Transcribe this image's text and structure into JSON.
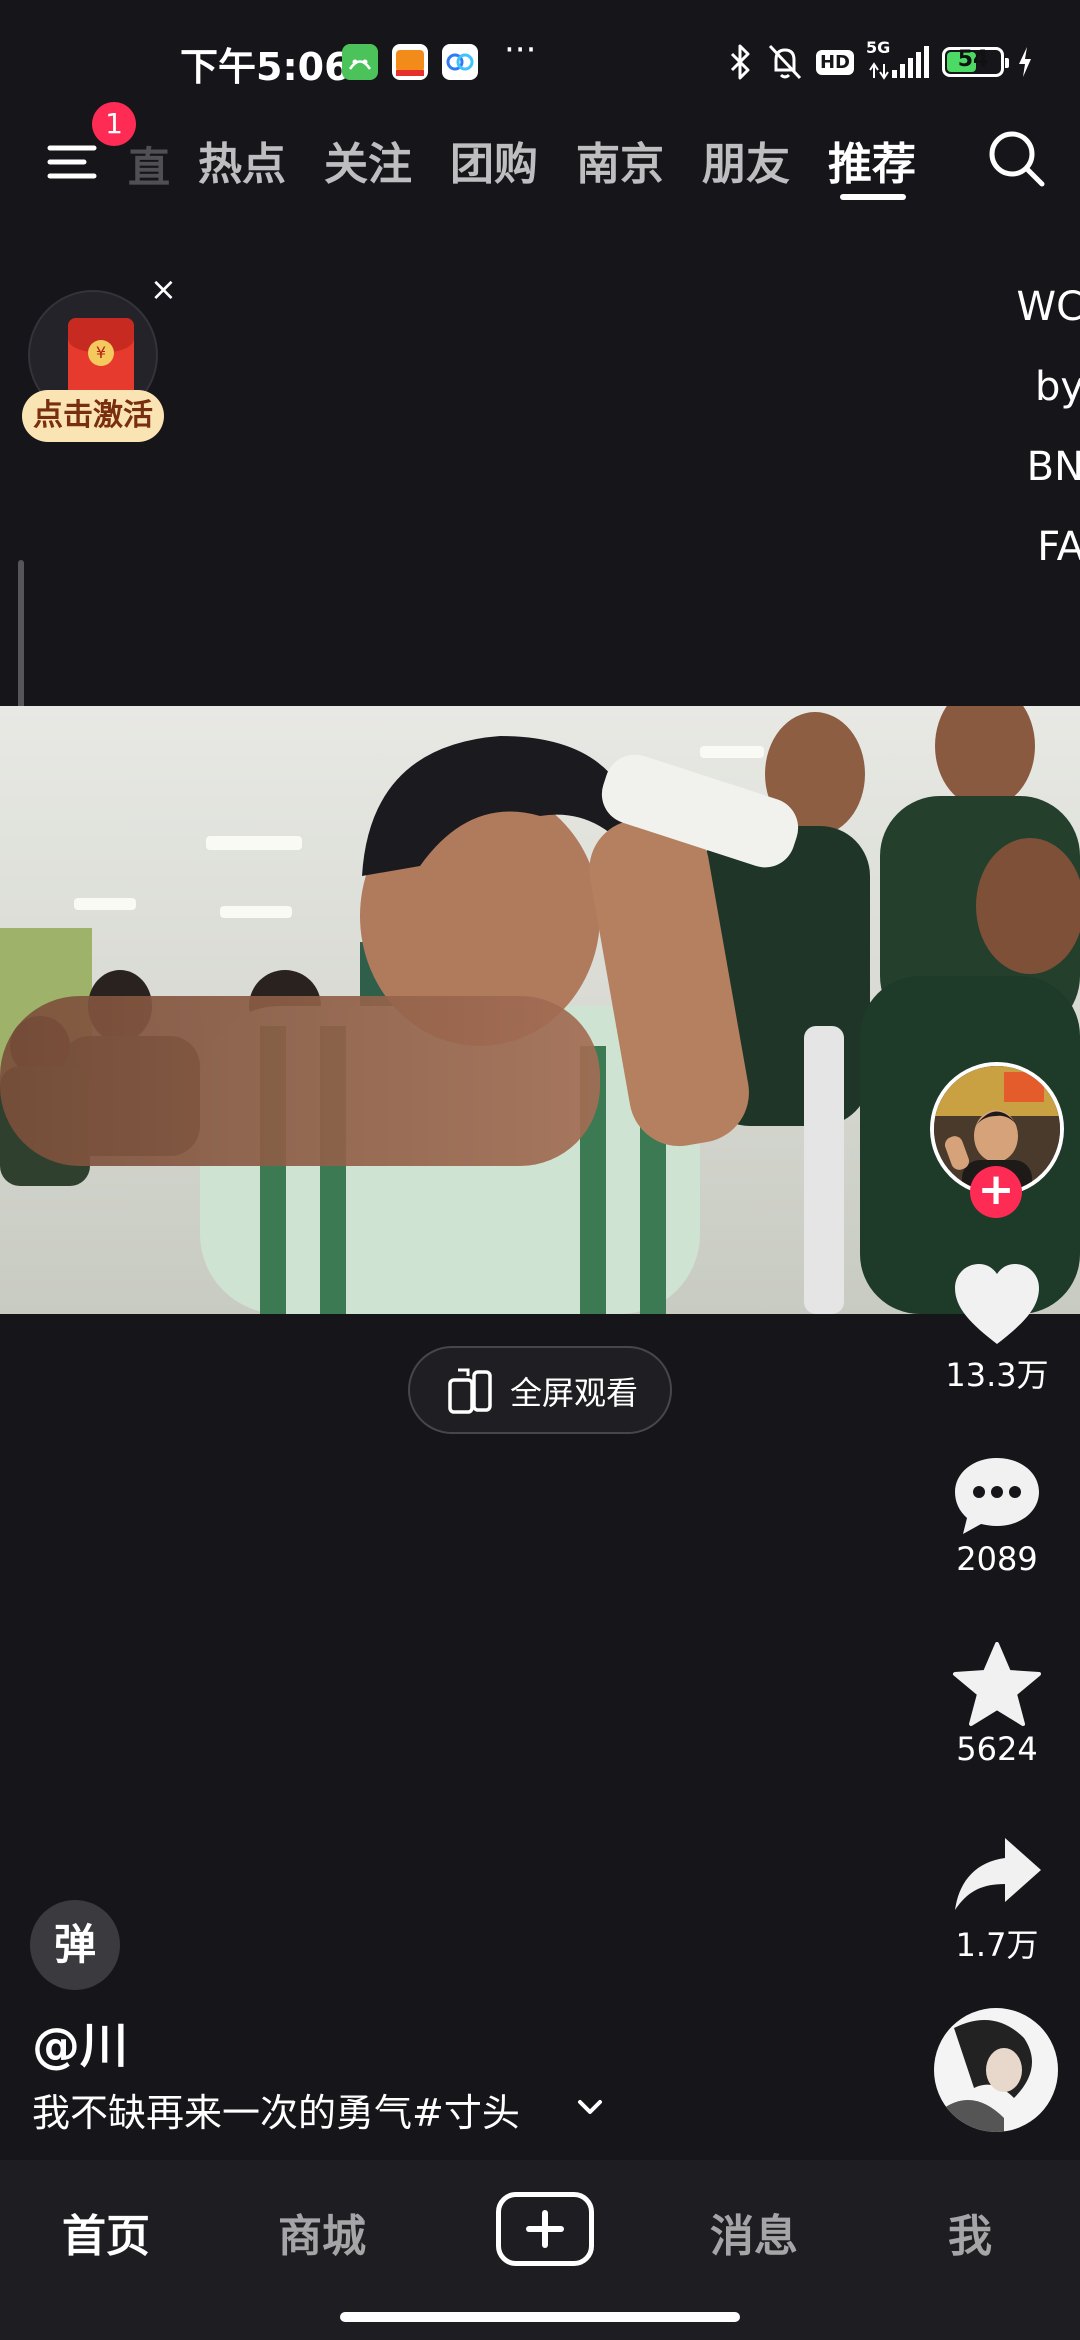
{
  "status_bar": {
    "time": "下午5:06",
    "app_icons": [
      "android-app-icon",
      "58-app-icon",
      "baidu-netdisk-icon"
    ],
    "more": "···",
    "network": "5G",
    "battery_level": 54,
    "battery_text": "54",
    "hd_label": "HD"
  },
  "top_nav": {
    "menu_badge": "1",
    "partial_tab": "直",
    "tabs": [
      "热点",
      "关注",
      "团购",
      "南京",
      "朋友",
      "推荐"
    ],
    "active_tab": "推荐"
  },
  "red_packet": {
    "label": "点击激活",
    "coin": "¥",
    "close": "×"
  },
  "side_text": [
    "WC",
    "by",
    "BN",
    "FA"
  ],
  "video": {
    "fullscreen_label": "全屏观看"
  },
  "actions": {
    "likes": "13.3万",
    "comments": "2089",
    "favorites": "5624",
    "shares": "1.7万",
    "follow": "+"
  },
  "post": {
    "danmaku": "弹",
    "author": "@川",
    "caption": "我不缺再来一次的勇气#寸头"
  },
  "tab_bar": {
    "home": "首页",
    "mall": "商城",
    "messages": "消息",
    "me": "我"
  },
  "colors": {
    "accent": "#fe2c55",
    "background": "#16151a",
    "tab_bar_bg": "#1e1d22",
    "battery_green": "#4cd964"
  }
}
